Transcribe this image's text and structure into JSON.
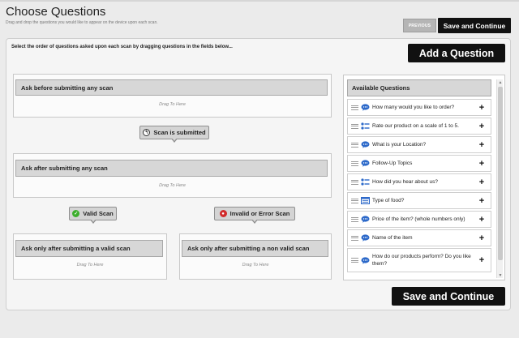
{
  "page": {
    "title": "Choose Questions",
    "subtitle": "Drag and drop the questions you would like to appear on the device upon each scan."
  },
  "toolbar": {
    "previous_label": "PREVIOUS",
    "save_continue_label": "Save and Continue"
  },
  "main": {
    "instruction": "Select the order of questions asked upon each scan by dragging questions in the fields below...",
    "add_question_label": "Add a Question",
    "zones": {
      "before": {
        "title": "Ask before submitting any scan",
        "hint": "Drag To Here"
      },
      "after": {
        "title": "Ask after submitting any scan",
        "hint": "Drag To Here"
      },
      "valid": {
        "title": "Ask only after submitting a valid scan",
        "hint": "Drag To Here"
      },
      "invalid": {
        "title": "Ask only after submitting a non valid scan",
        "hint": "Drag To Here"
      }
    },
    "markers": {
      "submitted": "Scan is submitted",
      "valid": "Valid Scan",
      "invalid": "Invalid or Error Scan"
    }
  },
  "available": {
    "title": "Available Questions",
    "items": [
      {
        "label": "How many would you like to order?",
        "type_icon": "chat-bubble-icon"
      },
      {
        "label": "Rate our product on a scale of 1 to 5.",
        "type_icon": "rating-scale-icon"
      },
      {
        "label": "What is your Location?",
        "type_icon": "chat-bubble-icon"
      },
      {
        "label": "Follow-Up Topics",
        "type_icon": "chat-bubble-icon"
      },
      {
        "label": "How did you hear about us?",
        "type_icon": "rating-scale-icon"
      },
      {
        "label": "Type of food?",
        "type_icon": "list-icon"
      },
      {
        "label": "Price of the item? (whole numbers only)",
        "type_icon": "chat-bubble-icon"
      },
      {
        "label": "Name of the item",
        "type_icon": "chat-bubble-icon"
      },
      {
        "label": "How do our products perform? Do you like them?",
        "type_icon": "chat-bubble-icon"
      }
    ]
  },
  "footer": {
    "save_continue_label": "Save and Continue"
  },
  "colors": {
    "primary_button": "#111111",
    "secondary_button": "#b5b5b5",
    "zone_header": "#d7d7d7",
    "valid_green": "#3cae2c",
    "invalid_red": "#d12a2a",
    "chat_blue": "#2b68c9"
  }
}
